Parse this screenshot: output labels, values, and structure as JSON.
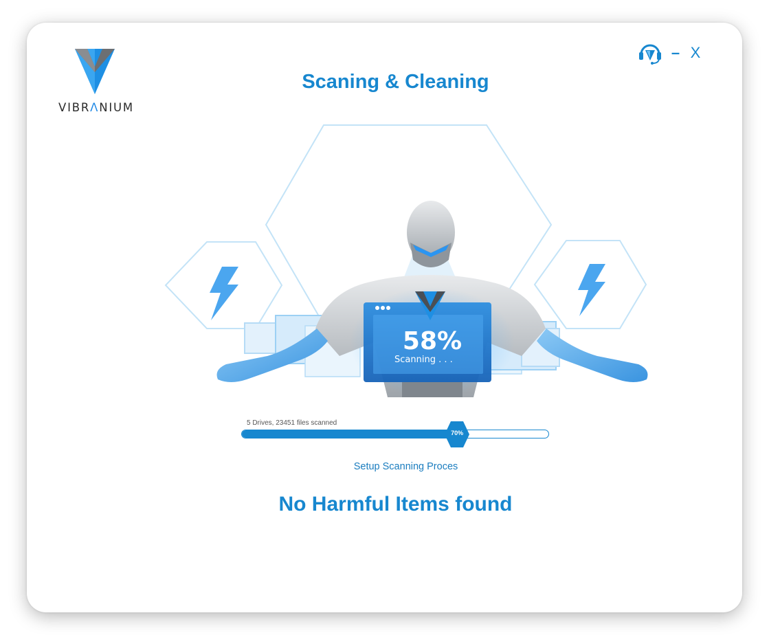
{
  "app": {
    "brand_prefix": "VIBR",
    "brand_accent": "Λ",
    "brand_suffix": "NIUM",
    "title": "Scaning & Cleaning"
  },
  "controls": {
    "support_icon": "headset-support-icon",
    "minimize_label": "–",
    "close_label": "X"
  },
  "scan": {
    "percent_label": "58%",
    "status_text": "Scanning . . .",
    "progress_caption": "5 Drives, 23451 files scanned",
    "progress_value": 70,
    "progress_label": "70%",
    "setup_link": "Setup Scanning Proces",
    "result_text": "No Harmful Items found"
  },
  "colors": {
    "accent": "#1787cf",
    "hex_outline": "#bfe0f5",
    "hand": "#5fb0ec"
  }
}
